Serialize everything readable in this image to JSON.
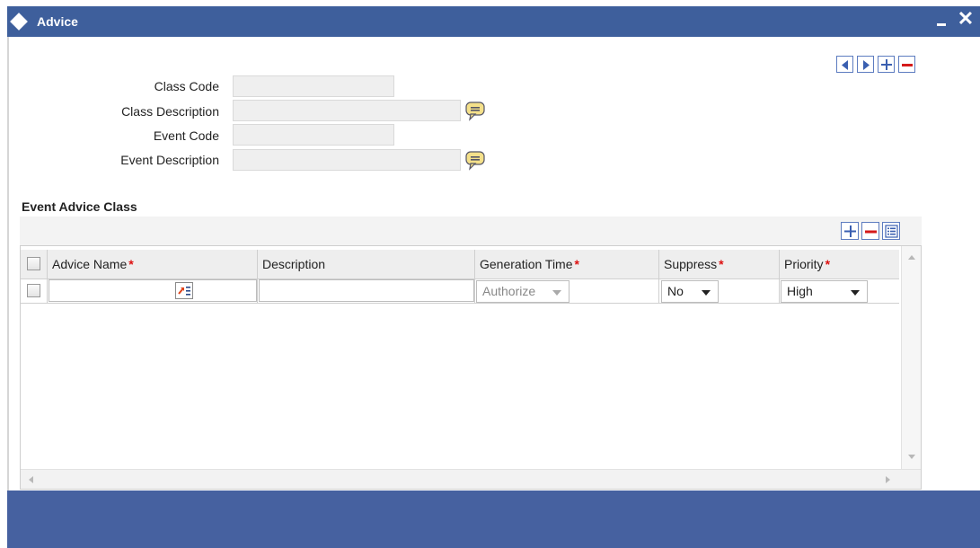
{
  "window": {
    "title": "Advice",
    "close_glyph": "✕"
  },
  "nav_buttons": [
    "previous-icon",
    "next-icon",
    "add-icon",
    "delete-icon"
  ],
  "form": {
    "class_code_label": "Class Code",
    "class_code_value": "",
    "class_description_label": "Class Description",
    "class_description_value": "",
    "event_code_label": "Event Code",
    "event_code_value": "",
    "event_description_label": "Event Description",
    "event_description_value": ""
  },
  "section": {
    "title": "Event Advice Class",
    "toolbar_buttons": [
      "add-row-icon",
      "delete-row-icon",
      "single-view-icon"
    ]
  },
  "grid": {
    "headers": {
      "advice_name": "Advice Name",
      "description": "Description",
      "generation_time": "Generation Time",
      "suppress": "Suppress",
      "priority": "Priority",
      "required_marker": "*"
    },
    "rows": [
      {
        "advice_name": "",
        "description": "",
        "generation_time": "Authorize",
        "suppress": "No",
        "priority": "High"
      }
    ]
  },
  "colors": {
    "titlebar": "#3e5f9c",
    "footer": "#4661a0",
    "required": "#dd1111",
    "button_border": "#5d7cc0"
  }
}
